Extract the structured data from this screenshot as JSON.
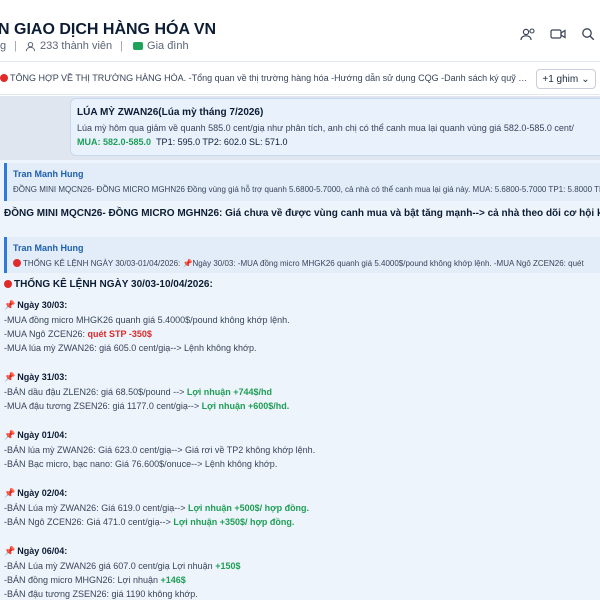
{
  "header": {
    "group_name": "N GIAO DỊCH HÀNG HÓA VN",
    "meta_prefix": "g",
    "members": "233 thành viên",
    "tag": "Gia đình"
  },
  "pin_bar": {
    "text": "TỔNG HỢP VỀ THỊ TRƯỜNG HÀNG HÓA. -Tổng quan về thị trường hàng hóa -Hướng dẫn sử dụng CQG -Danh sách ký quỹ hàng hóa -Phân tíc...",
    "more_label": "+1 ghim",
    "chevron": "⌄"
  },
  "message1": {
    "title": "LÚA MỲ ZWAN26(Lúa mỳ tháng 7/2026)",
    "body": "Lúa mỳ hôm qua giảm về quanh 585.0 cent/giạ như phân tích, anh chị có thể canh mua lại quanh vùng giá 582.0-585.0 cent/",
    "signal_label": "MUA: 582.0-585.0",
    "targets": "TP1: 595.0  TP2: 602.0  SL: 571.0"
  },
  "message2": {
    "quote_author": "Tran Manh Hung",
    "quote_text": "ĐỒNG MINI MQCN26- ĐỒNG MICRO MGHN26 Đồng vùng giá hỗ trợ quanh 5.6800-5.7000, cả nhà có thể canh mua lại giá này. MUA: 5.6800-5.7000 TP1: 5.8000 TP",
    "text": "ĐỒNG MINI MQCN26- ĐỒNG MICRO MGHN26: Giá chưa về được vùng canh mua và bật tăng mạnh--> cả nhà theo dõi cơ hội khác nhé."
  },
  "message3": {
    "quote_author": "Tran Manh Hung",
    "quote_text": "THỐNG KÊ LỆNH NGÀY 30/03-01/04/2026: 📌Ngày 30/03: -MUA đồng micro MHGK26 quanh giá 5.4000$/pound không khớp lệnh. -MUA Ngô ZCEN26: quét",
    "title": "THỐNG KÊ LỆNH NGÀY 30/03-10/04/2026:",
    "days": [
      {
        "label": "Ngày 30/03:",
        "lines": [
          {
            "text": "-MUA đồng micro MHGK26 quanh giá 5.4000$/pound không khớp lệnh.",
            "accent": "",
            "accent_class": ""
          },
          {
            "text": "-MUA Ngô ZCEN26: ",
            "accent": "quét STP -350$",
            "accent_class": "red"
          },
          {
            "text": "-MUA lúa mỳ ZWAN26: giá 605.0 cent/giạ--> Lệnh không khớp.",
            "accent": "",
            "accent_class": ""
          }
        ]
      },
      {
        "label": "Ngày 31/03:",
        "lines": [
          {
            "text": "-BÁN dầu đậu ZLEN26: giá 68.50$/pound --> ",
            "accent": "Lợi nhuận +744$/hd",
            "accent_class": "green"
          },
          {
            "text": "-MUA đậu tương ZSEN26: giá 1177.0 cent/giạ--> ",
            "accent": "Lợi nhuận +600$/hd.",
            "accent_class": "green"
          }
        ]
      },
      {
        "label": "Ngày 01/04:",
        "lines": [
          {
            "text": "-BÁN lúa mỳ ZWAN26: Giá 623.0 cent/giạ--> Giá rơi về TP2 không khớp lệnh.",
            "accent": "",
            "accent_class": ""
          },
          {
            "text": "-BÁN Bạc micro, bạc nano: Giá 76.600$/onuce--> Lệnh không khớp.",
            "accent": "",
            "accent_class": ""
          }
        ]
      },
      {
        "label": "Ngày 02/04:",
        "lines": [
          {
            "text": "-BÁN Lúa mỳ ZWAN26: Giá 619.0 cent/giạ--> ",
            "accent": "Lợi nhuận +500$/ hợp đồng.",
            "accent_class": "green"
          },
          {
            "text": "-BÁN Ngô ZCEN26: Giá 471.0 cent/giạ--> ",
            "accent": "Lợi nhuận +350$/ hợp đồng.",
            "accent_class": "green"
          }
        ]
      },
      {
        "label": "Ngày 06/04:",
        "lines": [
          {
            "text": "-BÁN Lúa mỳ ZWAN26 giá 607.0 cent/giạ Lợi nhuận ",
            "accent": "+150$",
            "accent_class": "green"
          },
          {
            "text": "-BÁN đồng micro MHGN26: Lợi nhuận ",
            "accent": "+146$",
            "accent_class": "green"
          },
          {
            "text": "-BÁN đậu tương ZSEN26: giá 1190 không khớp.",
            "accent": "",
            "accent_class": ""
          }
        ]
      }
    ]
  },
  "colors": {
    "accent_blue": "#2f7bd9",
    "profit_green": "#1f9e56",
    "loss_red": "#d92a2a"
  }
}
